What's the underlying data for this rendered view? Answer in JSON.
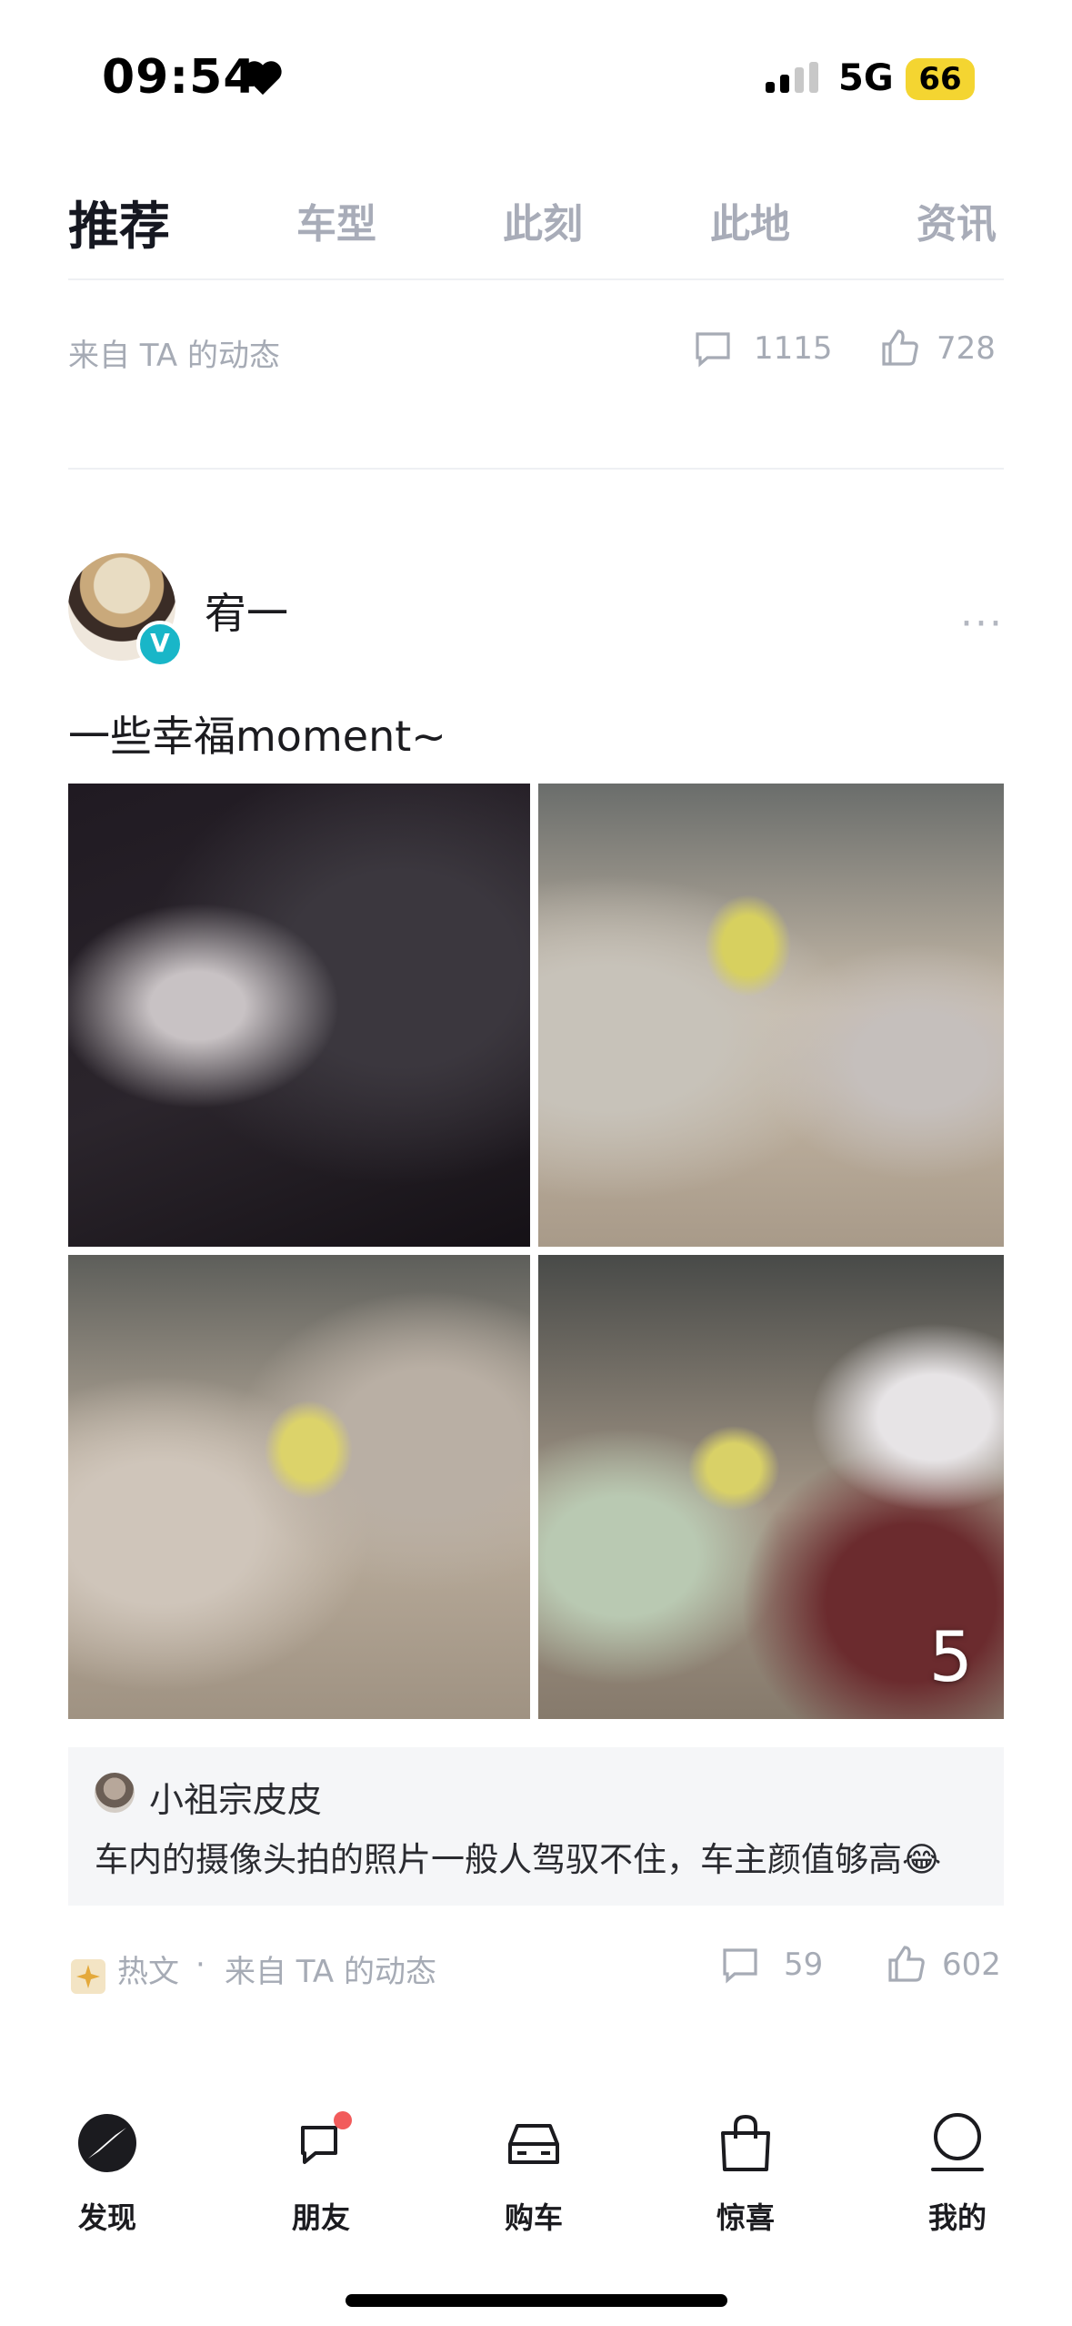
{
  "status_bar": {
    "time": "09:54",
    "network": "5G",
    "battery": "66"
  },
  "tabs": [
    {
      "label": "推荐",
      "active": true
    },
    {
      "label": "车型",
      "active": false
    },
    {
      "label": "此刻",
      "active": false
    },
    {
      "label": "此地",
      "active": false
    },
    {
      "label": "资讯",
      "active": false
    }
  ],
  "prev_post": {
    "source": "来自 TA 的动态",
    "comments": "1115",
    "likes": "728"
  },
  "post": {
    "username": "宥一",
    "verified_badge": "V",
    "text": "一些幸福moment~",
    "more_photos": "5",
    "comment": {
      "user": "小祖宗皮皮",
      "text": "车内的摄像头拍的照片一般人驾驭不住，车主颜值够高😂"
    },
    "meta": {
      "hot": "热文",
      "separator": "·",
      "source": "来自 TA 的动态",
      "comments": "59",
      "likes": "602"
    }
  },
  "bottom_nav": [
    {
      "label": "发现",
      "icon": "discover-icon"
    },
    {
      "label": "朋友",
      "icon": "friends-icon"
    },
    {
      "label": "购车",
      "icon": "car-icon"
    },
    {
      "label": "惊喜",
      "icon": "shopping-bag-icon"
    },
    {
      "label": "我的",
      "icon": "profile-icon"
    }
  ],
  "colors": {
    "accent": "#19b6c8",
    "notification": "#f25b5b",
    "muted": "#a6abb5"
  }
}
